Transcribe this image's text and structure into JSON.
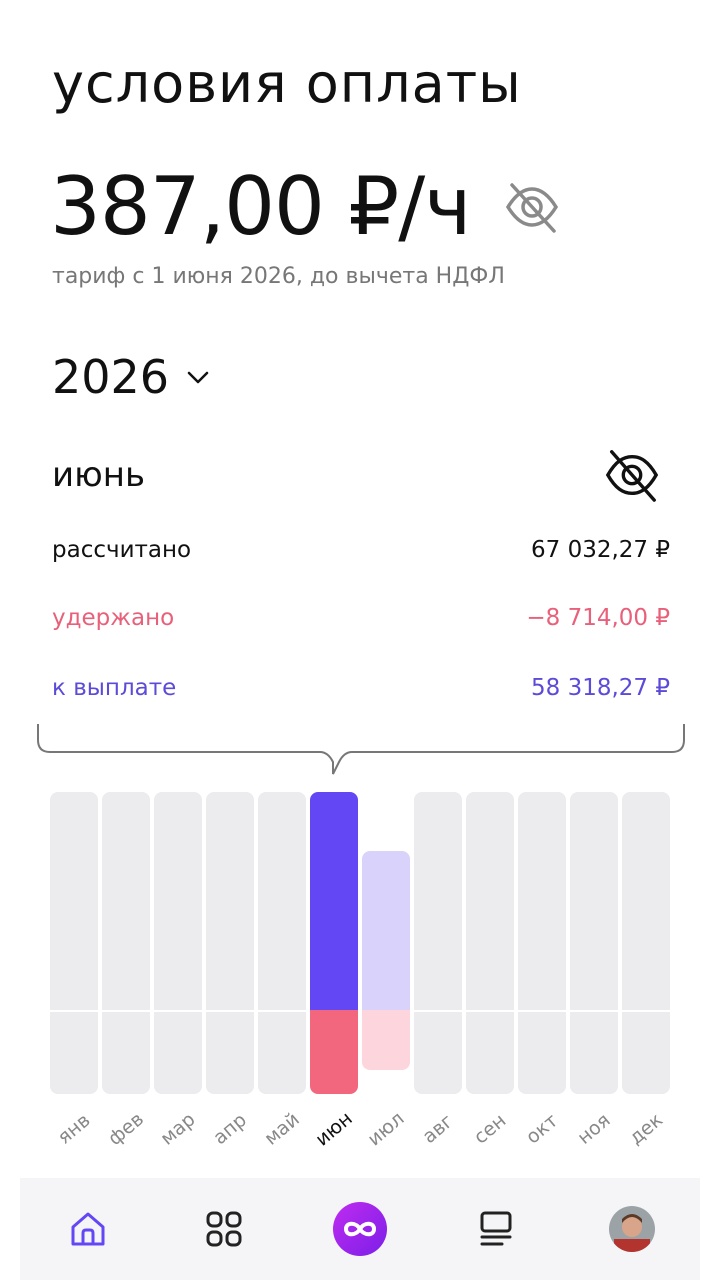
{
  "header": {
    "title": "условия оплаты",
    "rate": "387,00 ₽/ч",
    "rate_note": "тариф с 1 июня 2026, до вычета НДФЛ"
  },
  "year_selector": {
    "value": "2026"
  },
  "summary": {
    "month": "июнь",
    "rows": [
      {
        "label": "рассчитано",
        "value": "67 032,27 ₽"
      },
      {
        "label": "удержано",
        "value": "−8 714,00 ₽"
      },
      {
        "label": "к выплате",
        "value": "58 318,27 ₽"
      }
    ]
  },
  "chart_data": {
    "type": "bar",
    "categories": [
      "янв",
      "фев",
      "мар",
      "апр",
      "май",
      "июн",
      "июл",
      "авг",
      "сен",
      "окт",
      "ноя",
      "дек"
    ],
    "series": [
      {
        "values": [
          0,
          0,
          0,
          0,
          0,
          58318.27,
          null,
          0,
          0,
          0,
          0,
          0
        ]
      },
      {
        "values": [
          0,
          0,
          0,
          0,
          0,
          8714.0,
          null,
          0,
          0,
          0,
          0,
          0
        ]
      }
    ],
    "selected": "июн",
    "projected_level": {
      "июл": 0.73
    }
  },
  "colors": {
    "accent": "#6347f5",
    "accent_light": "#d9d3fc",
    "deduction": "#f2677e",
    "deduction_light": "#fcd6dc",
    "bar_bg": "#ececef"
  },
  "nav": {
    "items": [
      "home-icon",
      "apps-grid-icon",
      "infinity-icon",
      "document-list-icon",
      "profile-avatar"
    ]
  }
}
